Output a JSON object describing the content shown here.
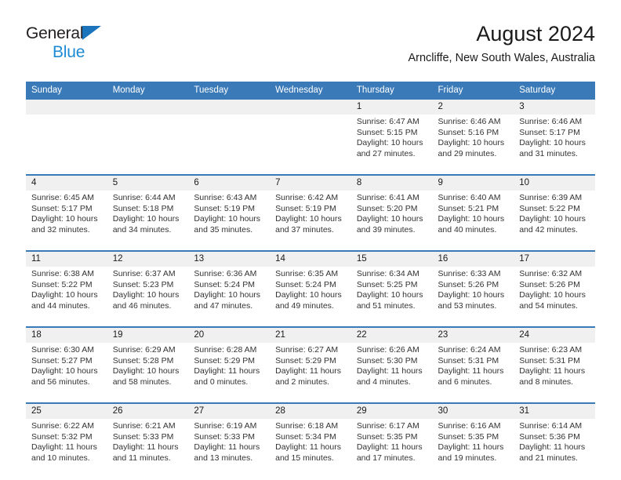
{
  "brand": {
    "name_part1": "General",
    "name_part2": "Blue",
    "triangle_color": "#1c75bc",
    "blue_text_color": "#1c8ad4"
  },
  "header": {
    "title": "August 2024",
    "subtitle": "Arncliffe, New South Wales, Australia"
  },
  "theme": {
    "header_blue": "#3a7ab8",
    "daynum_band": "#f0f0f0",
    "body_background": "#ffffff",
    "text_color": "#333333"
  },
  "weekday_headers": [
    "Sunday",
    "Monday",
    "Tuesday",
    "Wednesday",
    "Thursday",
    "Friday",
    "Saturday"
  ],
  "weeks": [
    {
      "days": [
        {
          "number": "",
          "lines": []
        },
        {
          "number": "",
          "lines": []
        },
        {
          "number": "",
          "lines": []
        },
        {
          "number": "",
          "lines": []
        },
        {
          "number": "1",
          "lines": [
            "Sunrise: 6:47 AM",
            "Sunset: 5:15 PM",
            "Daylight: 10 hours",
            "and 27 minutes."
          ]
        },
        {
          "number": "2",
          "lines": [
            "Sunrise: 6:46 AM",
            "Sunset: 5:16 PM",
            "Daylight: 10 hours",
            "and 29 minutes."
          ]
        },
        {
          "number": "3",
          "lines": [
            "Sunrise: 6:46 AM",
            "Sunset: 5:17 PM",
            "Daylight: 10 hours",
            "and 31 minutes."
          ]
        }
      ]
    },
    {
      "days": [
        {
          "number": "4",
          "lines": [
            "Sunrise: 6:45 AM",
            "Sunset: 5:17 PM",
            "Daylight: 10 hours",
            "and 32 minutes."
          ]
        },
        {
          "number": "5",
          "lines": [
            "Sunrise: 6:44 AM",
            "Sunset: 5:18 PM",
            "Daylight: 10 hours",
            "and 34 minutes."
          ]
        },
        {
          "number": "6",
          "lines": [
            "Sunrise: 6:43 AM",
            "Sunset: 5:19 PM",
            "Daylight: 10 hours",
            "and 35 minutes."
          ]
        },
        {
          "number": "7",
          "lines": [
            "Sunrise: 6:42 AM",
            "Sunset: 5:19 PM",
            "Daylight: 10 hours",
            "and 37 minutes."
          ]
        },
        {
          "number": "8",
          "lines": [
            "Sunrise: 6:41 AM",
            "Sunset: 5:20 PM",
            "Daylight: 10 hours",
            "and 39 minutes."
          ]
        },
        {
          "number": "9",
          "lines": [
            "Sunrise: 6:40 AM",
            "Sunset: 5:21 PM",
            "Daylight: 10 hours",
            "and 40 minutes."
          ]
        },
        {
          "number": "10",
          "lines": [
            "Sunrise: 6:39 AM",
            "Sunset: 5:22 PM",
            "Daylight: 10 hours",
            "and 42 minutes."
          ]
        }
      ]
    },
    {
      "days": [
        {
          "number": "11",
          "lines": [
            "Sunrise: 6:38 AM",
            "Sunset: 5:22 PM",
            "Daylight: 10 hours",
            "and 44 minutes."
          ]
        },
        {
          "number": "12",
          "lines": [
            "Sunrise: 6:37 AM",
            "Sunset: 5:23 PM",
            "Daylight: 10 hours",
            "and 46 minutes."
          ]
        },
        {
          "number": "13",
          "lines": [
            "Sunrise: 6:36 AM",
            "Sunset: 5:24 PM",
            "Daylight: 10 hours",
            "and 47 minutes."
          ]
        },
        {
          "number": "14",
          "lines": [
            "Sunrise: 6:35 AM",
            "Sunset: 5:24 PM",
            "Daylight: 10 hours",
            "and 49 minutes."
          ]
        },
        {
          "number": "15",
          "lines": [
            "Sunrise: 6:34 AM",
            "Sunset: 5:25 PM",
            "Daylight: 10 hours",
            "and 51 minutes."
          ]
        },
        {
          "number": "16",
          "lines": [
            "Sunrise: 6:33 AM",
            "Sunset: 5:26 PM",
            "Daylight: 10 hours",
            "and 53 minutes."
          ]
        },
        {
          "number": "17",
          "lines": [
            "Sunrise: 6:32 AM",
            "Sunset: 5:26 PM",
            "Daylight: 10 hours",
            "and 54 minutes."
          ]
        }
      ]
    },
    {
      "days": [
        {
          "number": "18",
          "lines": [
            "Sunrise: 6:30 AM",
            "Sunset: 5:27 PM",
            "Daylight: 10 hours",
            "and 56 minutes."
          ]
        },
        {
          "number": "19",
          "lines": [
            "Sunrise: 6:29 AM",
            "Sunset: 5:28 PM",
            "Daylight: 10 hours",
            "and 58 minutes."
          ]
        },
        {
          "number": "20",
          "lines": [
            "Sunrise: 6:28 AM",
            "Sunset: 5:29 PM",
            "Daylight: 11 hours",
            "and 0 minutes."
          ]
        },
        {
          "number": "21",
          "lines": [
            "Sunrise: 6:27 AM",
            "Sunset: 5:29 PM",
            "Daylight: 11 hours",
            "and 2 minutes."
          ]
        },
        {
          "number": "22",
          "lines": [
            "Sunrise: 6:26 AM",
            "Sunset: 5:30 PM",
            "Daylight: 11 hours",
            "and 4 minutes."
          ]
        },
        {
          "number": "23",
          "lines": [
            "Sunrise: 6:24 AM",
            "Sunset: 5:31 PM",
            "Daylight: 11 hours",
            "and 6 minutes."
          ]
        },
        {
          "number": "24",
          "lines": [
            "Sunrise: 6:23 AM",
            "Sunset: 5:31 PM",
            "Daylight: 11 hours",
            "and 8 minutes."
          ]
        }
      ]
    },
    {
      "days": [
        {
          "number": "25",
          "lines": [
            "Sunrise: 6:22 AM",
            "Sunset: 5:32 PM",
            "Daylight: 11 hours",
            "and 10 minutes."
          ]
        },
        {
          "number": "26",
          "lines": [
            "Sunrise: 6:21 AM",
            "Sunset: 5:33 PM",
            "Daylight: 11 hours",
            "and 11 minutes."
          ]
        },
        {
          "number": "27",
          "lines": [
            "Sunrise: 6:19 AM",
            "Sunset: 5:33 PM",
            "Daylight: 11 hours",
            "and 13 minutes."
          ]
        },
        {
          "number": "28",
          "lines": [
            "Sunrise: 6:18 AM",
            "Sunset: 5:34 PM",
            "Daylight: 11 hours",
            "and 15 minutes."
          ]
        },
        {
          "number": "29",
          "lines": [
            "Sunrise: 6:17 AM",
            "Sunset: 5:35 PM",
            "Daylight: 11 hours",
            "and 17 minutes."
          ]
        },
        {
          "number": "30",
          "lines": [
            "Sunrise: 6:16 AM",
            "Sunset: 5:35 PM",
            "Daylight: 11 hours",
            "and 19 minutes."
          ]
        },
        {
          "number": "31",
          "lines": [
            "Sunrise: 6:14 AM",
            "Sunset: 5:36 PM",
            "Daylight: 11 hours",
            "and 21 minutes."
          ]
        }
      ]
    }
  ]
}
